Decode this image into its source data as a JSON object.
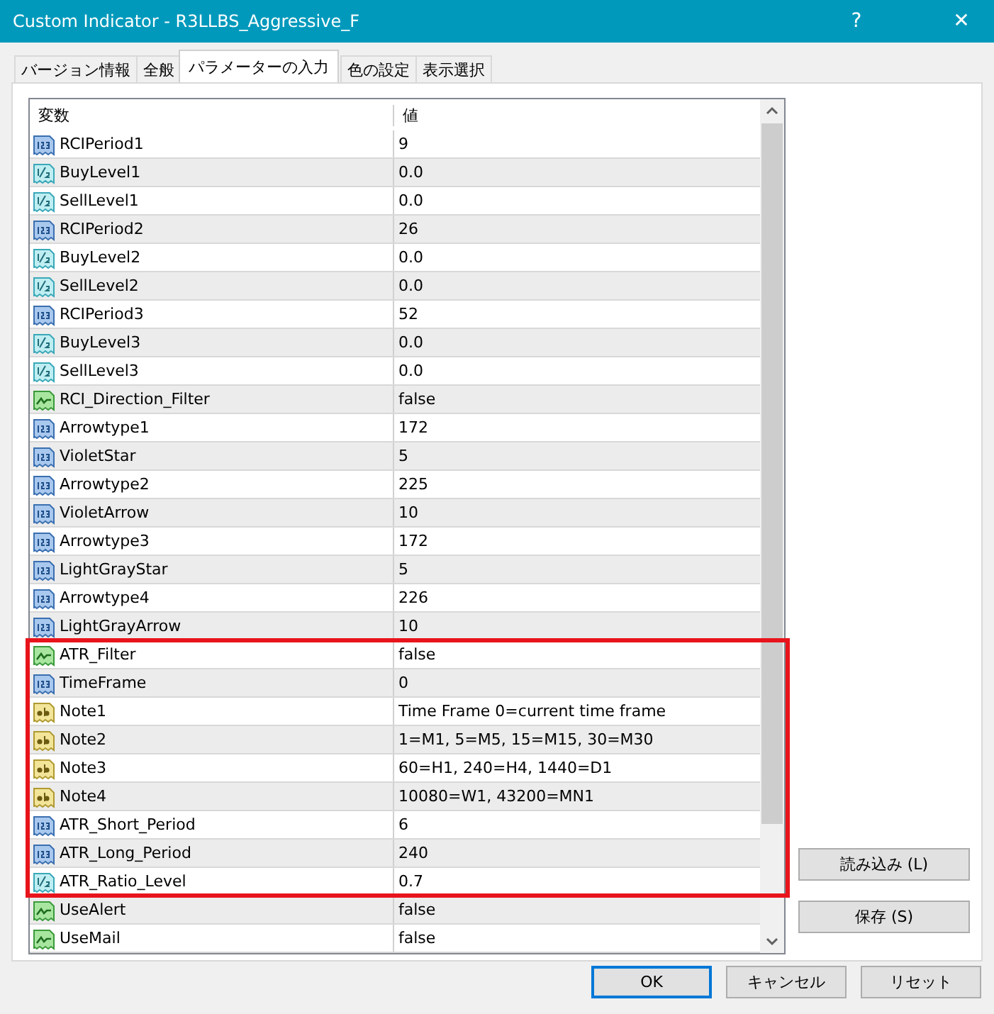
{
  "window": {
    "title": "Custom Indicator - R3LLBS_Aggressive_F",
    "help": "?",
    "close": "✕"
  },
  "tabs": [
    {
      "label": "バージョン情報",
      "selected": false
    },
    {
      "label": "全般",
      "selected": false
    },
    {
      "label": "パラメーターの入力",
      "selected": true
    },
    {
      "label": "色の設定",
      "selected": false
    },
    {
      "label": "表示選択",
      "selected": false
    }
  ],
  "table": {
    "columns": [
      "変数",
      "値"
    ],
    "sections": [
      {
        "highlighted": false,
        "rows": [
          {
            "kind": "int",
            "name": "RCIPeriod1",
            "value": "9"
          },
          {
            "kind": "double",
            "name": "BuyLevel1",
            "value": "0.0"
          },
          {
            "kind": "double",
            "name": "SellLevel1",
            "value": "0.0"
          },
          {
            "kind": "int",
            "name": "RCIPeriod2",
            "value": "26"
          },
          {
            "kind": "double",
            "name": "BuyLevel2",
            "value": "0.0"
          },
          {
            "kind": "double",
            "name": "SellLevel2",
            "value": "0.0"
          },
          {
            "kind": "int",
            "name": "RCIPeriod3",
            "value": "52"
          },
          {
            "kind": "double",
            "name": "BuyLevel3",
            "value": "0.0"
          },
          {
            "kind": "double",
            "name": "SellLevel3",
            "value": "0.0"
          },
          {
            "kind": "bool",
            "name": "RCI_Direction_Filter",
            "value": "false"
          },
          {
            "kind": "int",
            "name": "Arrowtype1",
            "value": "172"
          },
          {
            "kind": "int",
            "name": "VioletStar",
            "value": "5"
          },
          {
            "kind": "int",
            "name": "Arrowtype2",
            "value": "225"
          },
          {
            "kind": "int",
            "name": "VioletArrow",
            "value": "10"
          },
          {
            "kind": "int",
            "name": "Arrowtype3",
            "value": "172"
          },
          {
            "kind": "int",
            "name": "LightGrayStar",
            "value": "5"
          },
          {
            "kind": "int",
            "name": "Arrowtype4",
            "value": "226"
          },
          {
            "kind": "int",
            "name": "LightGrayArrow",
            "value": "10"
          }
        ]
      },
      {
        "highlighted": true,
        "rows": [
          {
            "kind": "bool",
            "name": "ATR_Filter",
            "value": "false"
          },
          {
            "kind": "int",
            "name": "TimeFrame",
            "value": "0"
          },
          {
            "kind": "string",
            "name": "Note1",
            "value": "Time Frame 0=current time frame"
          },
          {
            "kind": "string",
            "name": "Note2",
            "value": "1=M1, 5=M5, 15=M15, 30=M30"
          },
          {
            "kind": "string",
            "name": "Note3",
            "value": "60=H1, 240=H4, 1440=D1"
          },
          {
            "kind": "string",
            "name": "Note4",
            "value": "10080=W1, 43200=MN1"
          },
          {
            "kind": "int",
            "name": "ATR_Short_Period",
            "value": "6"
          },
          {
            "kind": "int",
            "name": "ATR_Long_Period",
            "value": "240"
          },
          {
            "kind": "double",
            "name": "ATR_Ratio_Level",
            "value": "0.7"
          }
        ]
      },
      {
        "highlighted": false,
        "rows": [
          {
            "kind": "bool",
            "name": "UseAlert",
            "value": "false"
          },
          {
            "kind": "bool",
            "name": "UseMail",
            "value": "false"
          }
        ]
      }
    ]
  },
  "side_buttons": [
    "読み込み (L)",
    "保存 (S)"
  ],
  "buttons": [
    {
      "label": "OK",
      "selected": true
    },
    {
      "label": "キャンセル",
      "selected": false
    },
    {
      "label": "リセット",
      "selected": false
    }
  ]
}
